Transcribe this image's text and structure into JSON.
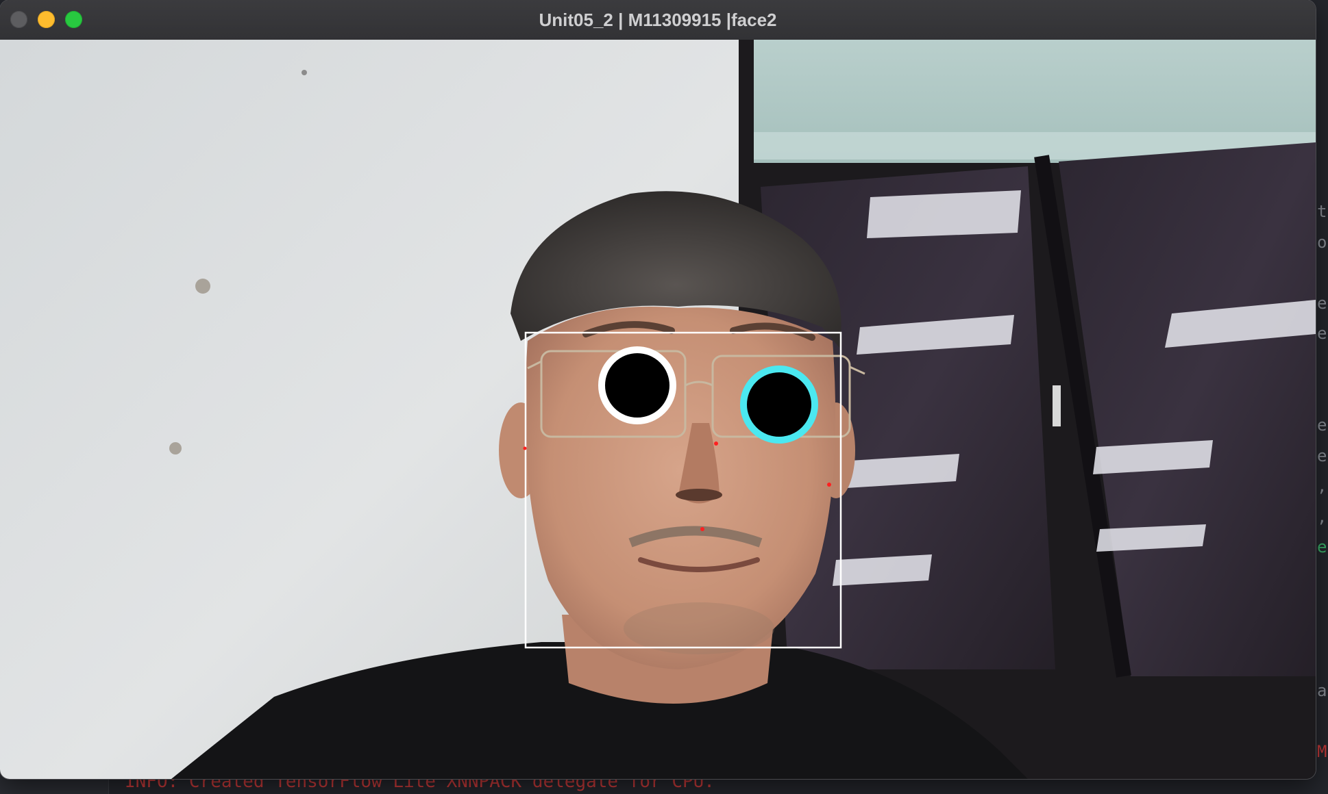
{
  "window": {
    "title": "Unit05_2 | M11309915 |face2"
  },
  "terminal": {
    "log_line": "INFO: Created TensorFlow Lite XNNPACK delegate for CPU.",
    "edge_fragments": [
      "t",
      "o",
      "e",
      "e",
      "e",
      "e",
      ",",
      ",",
      "e",
      "a",
      "M"
    ]
  },
  "overlay": {
    "colors": {
      "face_box": "#ffffff",
      "left_eye_ring": "#ffffff",
      "right_eye_ring": "#4be8f0",
      "pupil": "#000000",
      "landmark": "#ff2020"
    }
  }
}
